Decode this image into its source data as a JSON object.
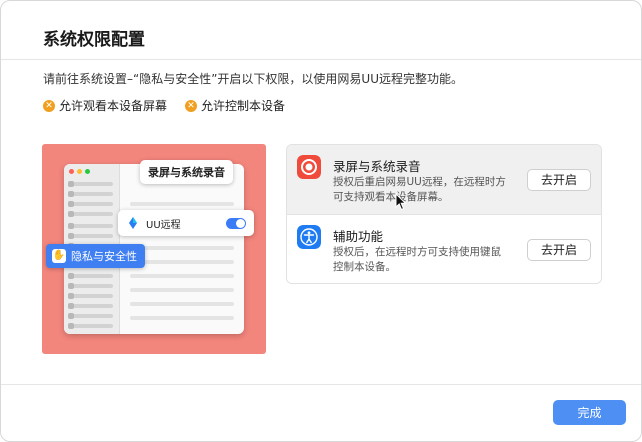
{
  "dialog": {
    "title": "系统权限配置",
    "intro": "请前往系统设置–“隐私与安全性”开启以下权限，以使用网易UU远程完整功能。",
    "permissions": [
      {
        "label": "允许观看本设备屏幕",
        "status_icon": "x-icon"
      },
      {
        "label": "允许控制本设备",
        "status_icon": "x-icon"
      }
    ],
    "done_label": "完成"
  },
  "illustration": {
    "callout": "录屏与系统录音",
    "app_label": "UU远程",
    "privacy_label": "隐私与安全性"
  },
  "settings": [
    {
      "title": "录屏与系统录音",
      "description": "授权后重启网易UU远程，在远程时方可支持观看本设备屏幕。",
      "button": "去开启",
      "icon": "screen-record-icon",
      "icon_color": "#ef4a3b"
    },
    {
      "title": "辅助功能",
      "description": "授权后，在远程时方可支持使用键鼠控制本设备。",
      "button": "去开启",
      "icon": "accessibility-icon",
      "icon_color": "#1f7bf2"
    }
  ],
  "colors": {
    "accent": "#4d8ff2",
    "warning": "#f0a020",
    "illustration_bg": "#f2857c"
  }
}
